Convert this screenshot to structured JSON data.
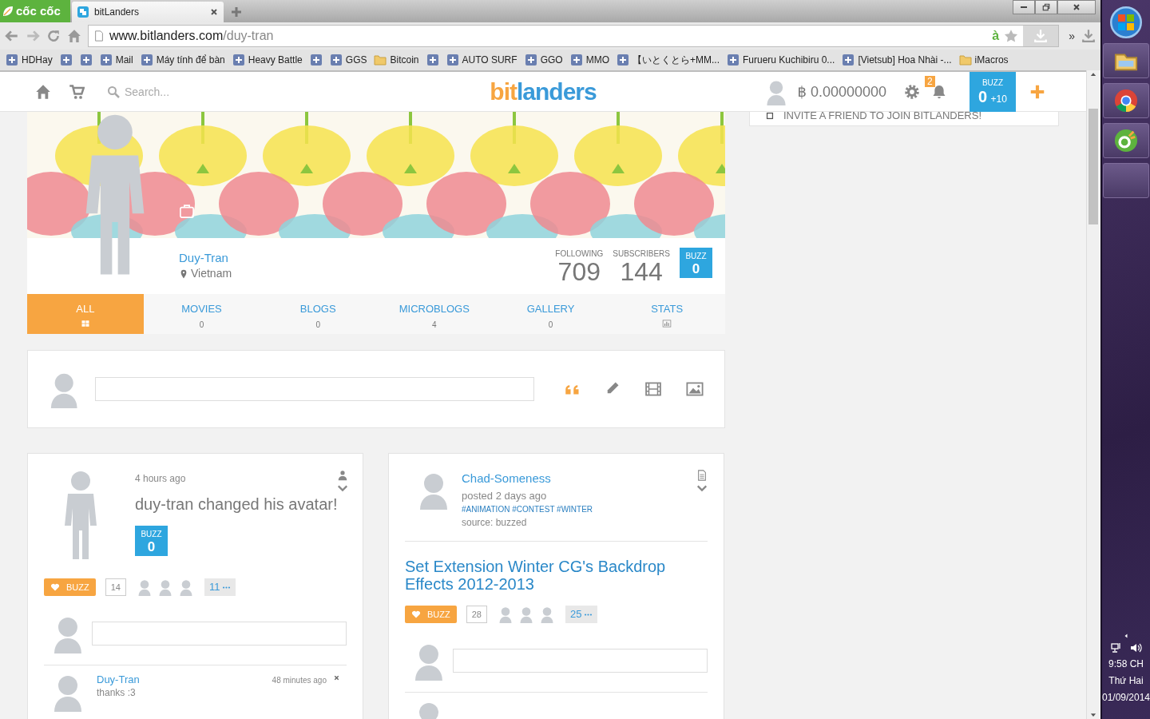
{
  "browser": {
    "brand": "cốc cốc",
    "tab": {
      "title": "bitLanders"
    },
    "url_host": "www.bitlanders.com",
    "url_path": "/duy-tran",
    "translate_mark": "à",
    "overflow": "»",
    "bookmarks": [
      {
        "kind": "link",
        "label": "HDHay"
      },
      {
        "kind": "link"
      },
      {
        "kind": "link"
      },
      {
        "kind": "link",
        "label": "Mail"
      },
      {
        "kind": "link",
        "label": "Máy tính để bàn"
      },
      {
        "kind": "link",
        "label": "Heavy Battle"
      },
      {
        "kind": "link"
      },
      {
        "kind": "link",
        "label": "GGS"
      },
      {
        "kind": "folder",
        "label": "Bitcoin"
      },
      {
        "kind": "link"
      },
      {
        "kind": "link",
        "label": "AUTO SURF"
      },
      {
        "kind": "link",
        "label": "GGO"
      },
      {
        "kind": "link",
        "label": "MMO"
      },
      {
        "kind": "link",
        "label": "【いとくとら+MM..."
      },
      {
        "kind": "link",
        "label": "Furueru Kuchibiru 0..."
      },
      {
        "kind": "link",
        "label": "[Vietsub] Hoa Nhài -..."
      },
      {
        "kind": "folder",
        "label": "iMacros"
      }
    ]
  },
  "site_header": {
    "search_placeholder": "Search...",
    "logo": {
      "first": "bit",
      "rest": "landers"
    },
    "balance": "฿ 0.00000000",
    "notification_count": "2",
    "buzz": {
      "label": "BUZZ",
      "value": "0",
      "bonus": "+10"
    }
  },
  "sidebar": {
    "invite": "INVITE A FRIEND TO JOIN BITLANDERS!"
  },
  "profile": {
    "name": "Duy-Tran",
    "location": "Vietnam",
    "stats": [
      {
        "label": "FOLLOWING",
        "value": "709"
      },
      {
        "label": "SUBSCRIBERS",
        "value": "144"
      }
    ],
    "buzz": {
      "label": "BUZZ",
      "value": "0"
    }
  },
  "tabs": [
    {
      "label": "ALL",
      "selected": true
    },
    {
      "label": "MOVIES",
      "count": "0",
      "selected": false
    },
    {
      "label": "BLOGS",
      "count": "0",
      "selected": false
    },
    {
      "label": "MICROBLOGS",
      "count": "4",
      "selected": false
    },
    {
      "label": "GALLERY",
      "count": "0",
      "selected": false
    },
    {
      "label": "STATS",
      "selected": false
    }
  ],
  "posts": [
    {
      "kind": "activity",
      "time": "4 hours ago",
      "text": "duy-tran changed his avatar!",
      "buzz_box": {
        "label": "BUZZ",
        "value": "0"
      },
      "buzz_button": "BUZZ",
      "buzz_count": "14",
      "more_count": "11",
      "comment": {
        "author": "Duy-Tran",
        "time": "48 minutes ago",
        "text": "thanks :3"
      }
    },
    {
      "kind": "article",
      "author": "Chad-Someness",
      "meta": "posted 2 days ago",
      "tags": "#ANIMATION #CONTEST #WINTER",
      "source": "source: buzzed",
      "title": "Set Extension Winter CG's Backdrop Effects 2012-2013",
      "buzz_button": "BUZZ",
      "buzz_count": "28",
      "more_count": "25"
    }
  ],
  "taskbar": {
    "time": "9:58 CH",
    "day": "Thứ Hai",
    "date": "01/09/2014"
  }
}
